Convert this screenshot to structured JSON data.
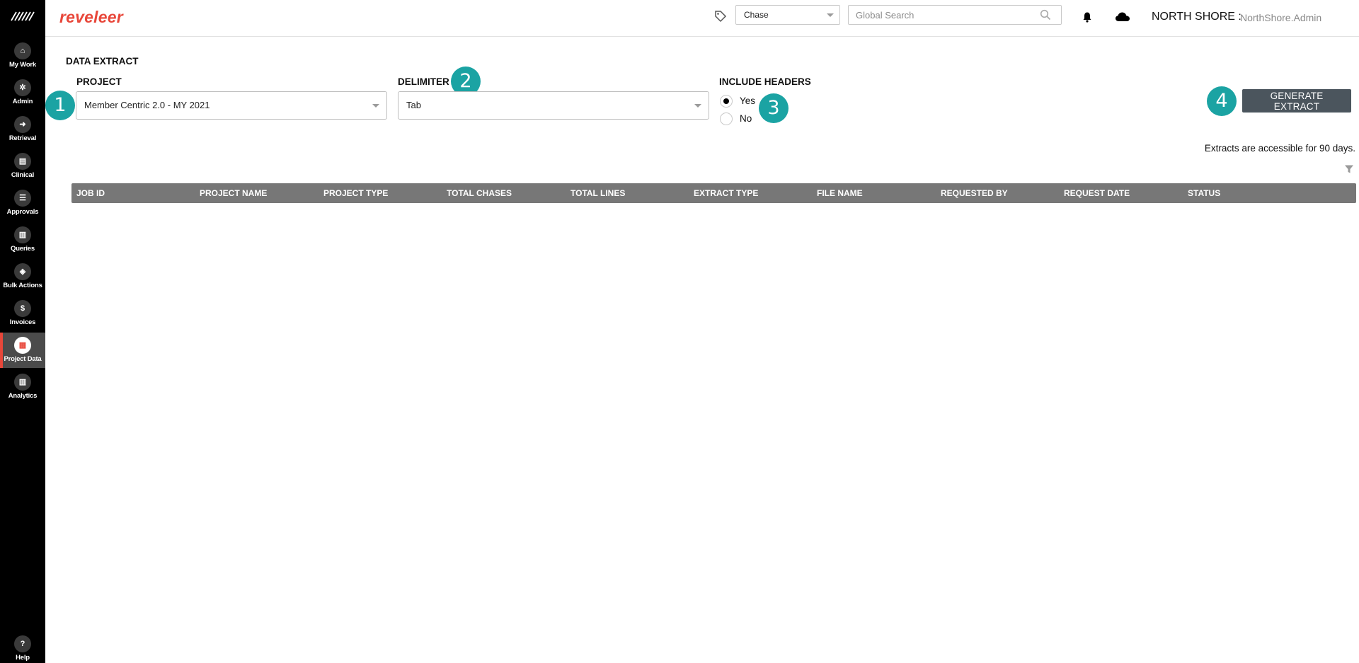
{
  "app": {
    "brand": "reveleer"
  },
  "sidebar": {
    "items": [
      {
        "label": "My Work",
        "icon": "home-icon",
        "active": false
      },
      {
        "label": "Admin",
        "icon": "admin-icon",
        "active": false
      },
      {
        "label": "Retrieval",
        "icon": "retrieval-icon",
        "active": false
      },
      {
        "label": "Clinical",
        "icon": "clinical-icon",
        "active": false
      },
      {
        "label": "Approvals",
        "icon": "approvals-icon",
        "active": false
      },
      {
        "label": "Queries",
        "icon": "queries-icon",
        "active": false
      },
      {
        "label": "Bulk Actions",
        "icon": "bulk-actions-icon",
        "active": false
      },
      {
        "label": "Invoices",
        "icon": "invoices-icon",
        "active": false
      },
      {
        "label": "Project Data",
        "icon": "project-data-icon",
        "active": true
      },
      {
        "label": "Analytics",
        "icon": "analytics-icon",
        "active": false
      }
    ],
    "help": {
      "label": "Help",
      "icon": "help-icon"
    }
  },
  "topbar": {
    "type_select": "Chase",
    "search_placeholder": "Global Search",
    "org_name": "NORTH SHORE :",
    "username": "NorthShore.Admin"
  },
  "page": {
    "title": "DATA EXTRACT",
    "project_label": "PROJECT",
    "project_value": "Member Centric 2.0 - MY 2021",
    "delimiter_label": "DELIMITER",
    "delimiter_value": "Tab",
    "headers_label": "INCLUDE HEADERS",
    "headers_options": [
      "Yes",
      "No"
    ],
    "headers_selected": "Yes",
    "generate_button": "GENERATE EXTRACT",
    "note": "Extracts are accessible for 90 days.",
    "badges": [
      "1",
      "2",
      "3",
      "4"
    ]
  },
  "table": {
    "columns": [
      "JOB ID",
      "PROJECT NAME",
      "PROJECT TYPE",
      "TOTAL CHASES",
      "TOTAL LINES",
      "EXTRACT TYPE",
      "FILE NAME",
      "REQUESTED BY",
      "REQUEST DATE",
      "STATUS"
    ],
    "rows": []
  },
  "colors": {
    "brand": "#e8473a",
    "badge": "#1ba3a3",
    "button": "#4b555d",
    "table_header": "#777777"
  }
}
